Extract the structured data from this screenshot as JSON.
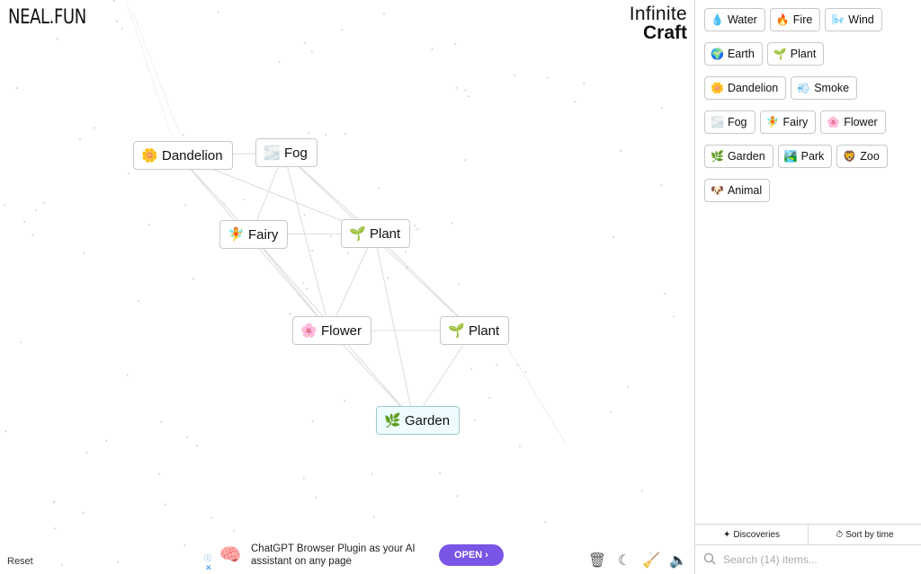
{
  "logo": "NEAL.FUN",
  "title": {
    "line1": "Infinite",
    "line2": "Craft"
  },
  "canvas_items": [
    {
      "label": "Dandelion",
      "icon": "🌼",
      "icon_name": "dandelion-icon",
      "selected": false
    },
    {
      "label": "Fog",
      "icon": "🌫️",
      "icon_name": "fog-icon",
      "selected": false
    },
    {
      "label": "Fairy",
      "icon": "🧚",
      "icon_name": "fairy-icon",
      "selected": false
    },
    {
      "label": "Plant",
      "icon": "🌱",
      "icon_name": "plant-icon",
      "selected": false
    },
    {
      "label": "Flower",
      "icon": "🌸",
      "icon_name": "flower-icon",
      "selected": false
    },
    {
      "label": "Plant",
      "icon": "🌱",
      "icon_name": "plant-icon",
      "selected": false
    },
    {
      "label": "Garden",
      "icon": "🌿",
      "icon_name": "garden-icon",
      "selected": true
    }
  ],
  "reset_label": "Reset",
  "ad": {
    "text": "ChatGPT Browser Plugin as your AI assistant on any page",
    "button": "OPEN ›",
    "info": "ⓘ",
    "close": "✕"
  },
  "tools": [
    {
      "name": "trash-icon",
      "glyph": "🗑"
    },
    {
      "name": "dark-mode-icon",
      "glyph": "☾"
    },
    {
      "name": "broom-icon",
      "glyph": "🧹"
    },
    {
      "name": "sound-icon",
      "glyph": "🔈"
    }
  ],
  "sidebar": {
    "items": [
      {
        "label": "Water",
        "icon": "💧",
        "icon_name": "water-icon"
      },
      {
        "label": "Fire",
        "icon": "🔥",
        "icon_name": "fire-icon"
      },
      {
        "label": "Wind",
        "icon": "🌬️",
        "icon_name": "wind-icon"
      },
      {
        "label": "Earth",
        "icon": "🌍",
        "icon_name": "earth-icon"
      },
      {
        "label": "Plant",
        "icon": "🌱",
        "icon_name": "plant-icon"
      },
      {
        "label": "Dandelion",
        "icon": "🌼",
        "icon_name": "dandelion-icon"
      },
      {
        "label": "Smoke",
        "icon": "💨",
        "icon_name": "smoke-icon"
      },
      {
        "label": "Fog",
        "icon": "🌫️",
        "icon_name": "fog-icon"
      },
      {
        "label": "Fairy",
        "icon": "🧚",
        "icon_name": "fairy-icon"
      },
      {
        "label": "Flower",
        "icon": "🌸",
        "icon_name": "flower-icon"
      },
      {
        "label": "Garden",
        "icon": "🌿",
        "icon_name": "garden-icon"
      },
      {
        "label": "Park",
        "icon": "🏞️",
        "icon_name": "park-icon"
      },
      {
        "label": "Zoo",
        "icon": "🦁",
        "icon_name": "zoo-icon"
      },
      {
        "label": "Animal",
        "icon": "🐶",
        "icon_name": "animal-icon"
      }
    ],
    "tabs": [
      {
        "label": "Discoveries",
        "icon": "✦"
      },
      {
        "label": "Sort by time",
        "icon": "⏱"
      }
    ],
    "search_placeholder": "Search (14) items..."
  }
}
